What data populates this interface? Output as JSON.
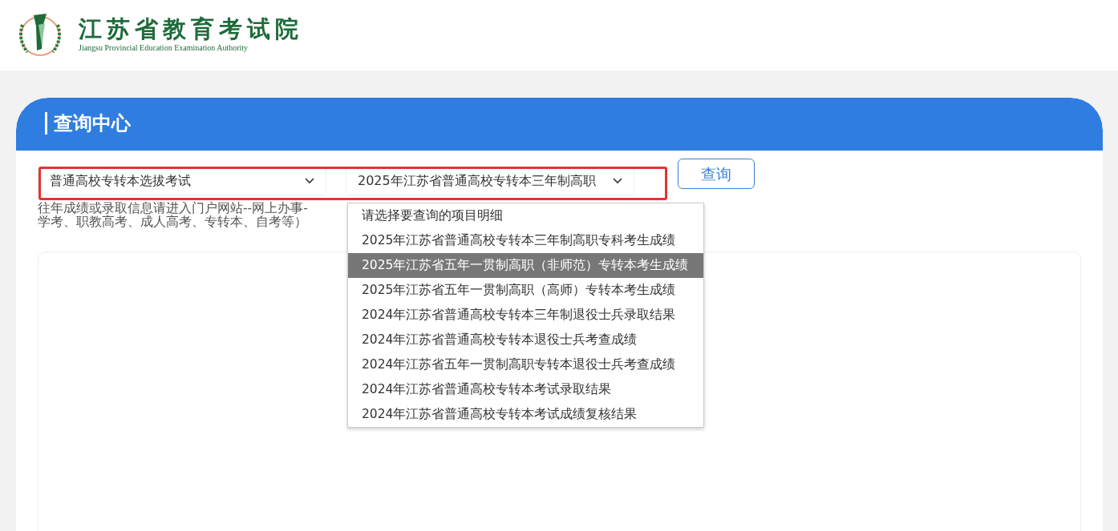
{
  "header": {
    "title": "江苏省教育考试院",
    "subtitle": "Jiangsu Provincial Education Examination Authority"
  },
  "panel": {
    "title": "查询中心",
    "exam_select": {
      "value": "普通高校专转本选拔考试"
    },
    "item_select": {
      "value": "2025年江苏省普通高校专转本三年制高职"
    },
    "search_button": "查询",
    "note_lines": [
      "往年成绩或录取信息请进入门户网站--网上办事-",
      "学考、职教高考、成人高考、专转本、自考等）"
    ],
    "dropdown_options": [
      {
        "label": "请选择要查询的项目明细",
        "selected": false
      },
      {
        "label": "2025年江苏省普通高校专转本三年制高职专科考生成绩",
        "selected": false
      },
      {
        "label": "2025年江苏省五年一贯制高职（非师范）专转本考生成绩",
        "selected": true
      },
      {
        "label": "2025年江苏省五年一贯制高职（高师）专转本考生成绩",
        "selected": false
      },
      {
        "label": "2024年江苏省普通高校专转本三年制退役士兵录取结果",
        "selected": false
      },
      {
        "label": "2024年江苏省普通高校专转本退役士兵考查成绩",
        "selected": false
      },
      {
        "label": "2024年江苏省五年一贯制高职专转本退役士兵考查成绩",
        "selected": false
      },
      {
        "label": "2024年江苏省普通高校专转本考试录取结果",
        "selected": false
      },
      {
        "label": "2024年江苏省普通高校专转本考试成绩复核结果",
        "selected": false
      }
    ]
  }
}
